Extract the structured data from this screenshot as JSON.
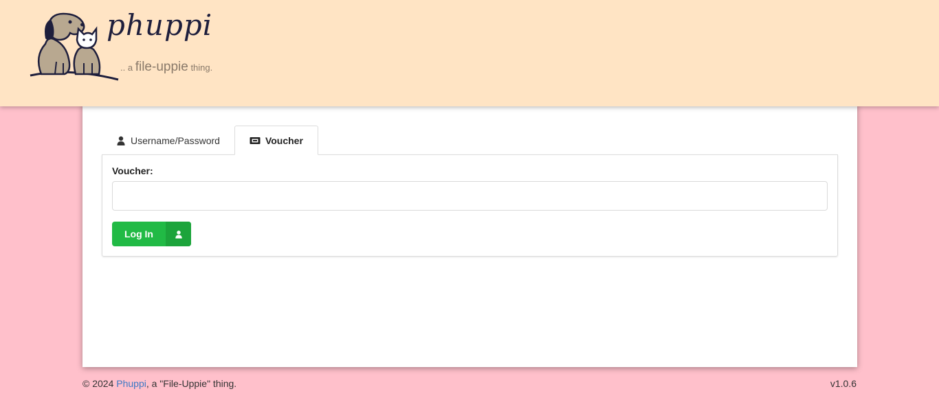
{
  "header": {
    "logo": {
      "name": "phuppi",
      "tag_prefix": ".. a",
      "tag_brand": "file-uppie",
      "tag_suffix": "thing.",
      "icon": "dog-and-cat-logo"
    },
    "background_color": "#ffe4c4"
  },
  "login": {
    "tabs": [
      {
        "label": "Username/Password",
        "icon": "user-icon",
        "active": false
      },
      {
        "label": "Voucher",
        "icon": "ticket-icon",
        "active": true
      }
    ],
    "voucher": {
      "label": "Voucher:",
      "value": "",
      "placeholder": ""
    },
    "submit": {
      "label": "Log In",
      "icon": "user-icon",
      "color": "#21ba45"
    }
  },
  "footer": {
    "copyright": "© 2024",
    "link_text": "Phuppi",
    "suffix": ", a \"File-Uppie\" thing.",
    "version": "v1.0.6"
  },
  "page": {
    "background_color": "#ffc0cb"
  }
}
